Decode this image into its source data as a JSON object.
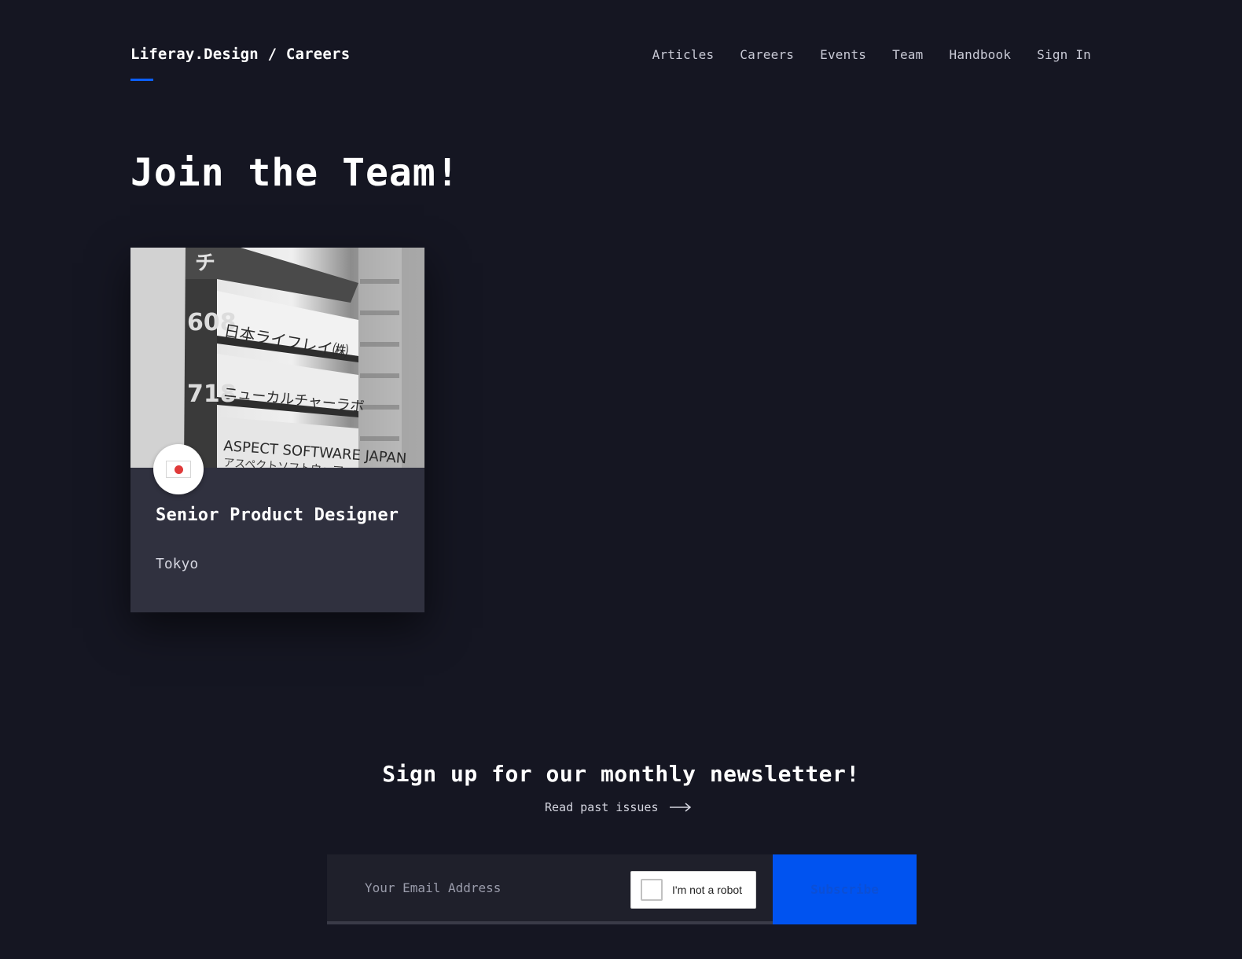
{
  "header": {
    "brand": "Liferay.Design / Careers",
    "nav": [
      "Articles",
      "Careers",
      "Events",
      "Team",
      "Handbook",
      "Sign In"
    ]
  },
  "hero": {
    "title": "Join the Team!"
  },
  "job": {
    "title": "Senior Product Designer",
    "location": "Tokyo",
    "flag_icon": "japan-flag-icon",
    "photo_text": {
      "line1_number": "608",
      "line1_label": "日本ライフレイ㈱",
      "line2_number": "718",
      "line2_label": "ニューカルチャーラボ",
      "line3_label": "ASPECT SOFTWARE JAPAN",
      "line3_sub": "アスペクトソフトウェア"
    }
  },
  "newsletter": {
    "title": "Sign up for our monthly newsletter!",
    "past_issues": "Read past issues",
    "email_placeholder": "Your Email Address",
    "captcha_label": "I'm not a robot",
    "subscribe_label": "Subscribe"
  },
  "colors": {
    "background": "#151622",
    "accent": "#0b5fff",
    "card": "#30313f",
    "button": "#0053f0"
  }
}
